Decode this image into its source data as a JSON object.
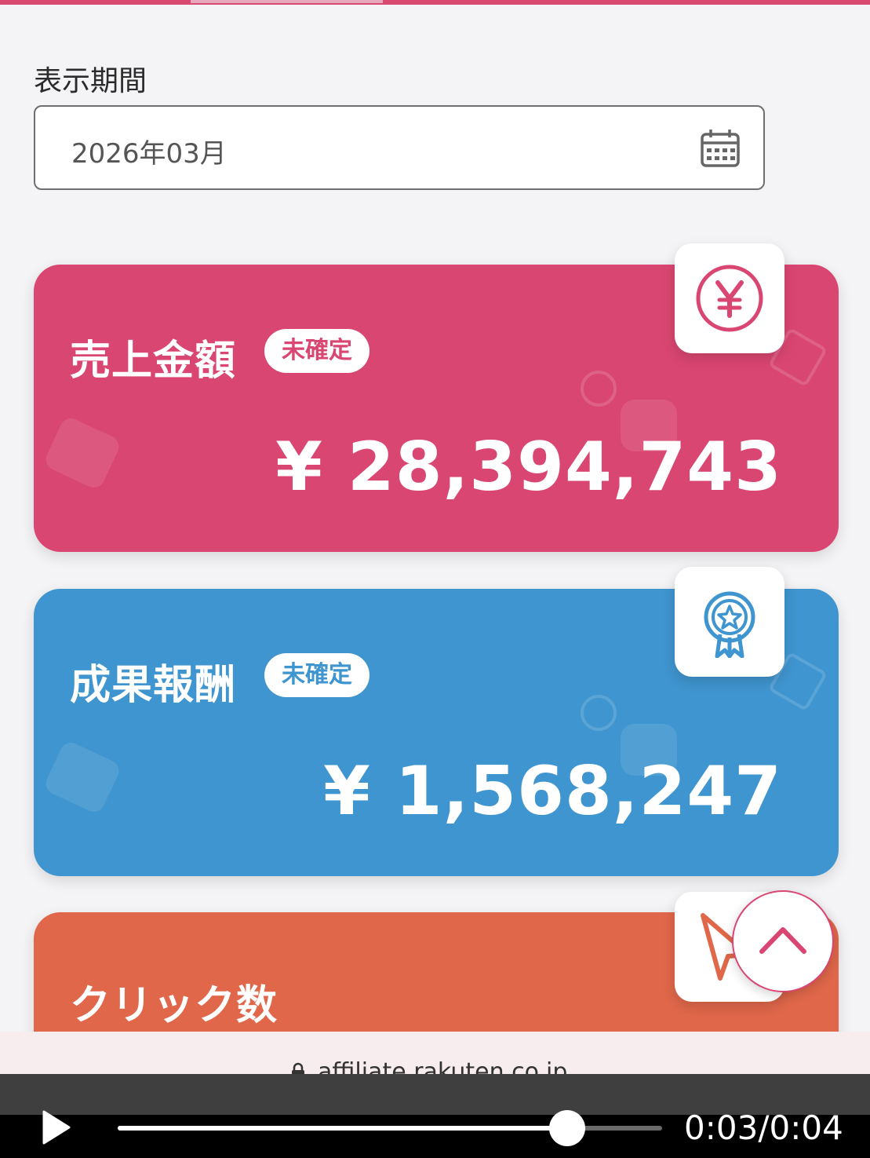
{
  "period": {
    "label": "表示期間",
    "value": "2026年03月"
  },
  "cards": [
    {
      "title": "売上金額",
      "badge": "未確定",
      "amount": "¥ 28,394,743",
      "icon": "yen-circle-icon",
      "color": "#d94671"
    },
    {
      "title": "成果報酬",
      "badge": "未確定",
      "amount": "¥ 1,568,247",
      "icon": "award-ribbon-icon",
      "color": "#3f95cf"
    },
    {
      "title": "クリック数",
      "icon": "cursor-click-icon",
      "color": "#e0674a"
    }
  ],
  "url": "affiliate.rakuten.co.jp",
  "video": {
    "current": "0:03",
    "separator": "/",
    "duration": "0:04",
    "progress": 0.825
  }
}
